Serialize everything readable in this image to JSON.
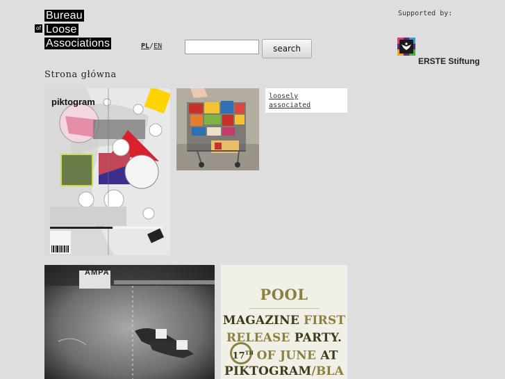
{
  "header": {
    "logo_lines": [
      "Bureau",
      "of",
      "Loose",
      "Associations"
    ],
    "lang_pl": "PL",
    "lang_sep": "/",
    "lang_en": "EN"
  },
  "search": {
    "value": "",
    "placeholder": "",
    "button_label": "search"
  },
  "sponsor": {
    "supported_label": "Supported by:",
    "name": "ERSTE Stiftung"
  },
  "page": {
    "title": "Strona główna"
  },
  "tiles": {
    "link_text": "loosely associated",
    "piktogram_brand": "piktogram",
    "race_sign": "AMPA",
    "pool": {
      "title": "POOL",
      "line1a": "MAGAZINE",
      "line1b": "FIRST",
      "line2a": "RELEASE",
      "line2b": "PARTY.",
      "day": "17",
      "day_suffix": "TH",
      "line3a": "OF JUNE",
      "line3b": "AT",
      "line4a": "PIKTOGRAM",
      "line4b": "/BLA"
    }
  },
  "colors": {
    "background": "#dedede",
    "pool_olive": "#8d7f42"
  }
}
